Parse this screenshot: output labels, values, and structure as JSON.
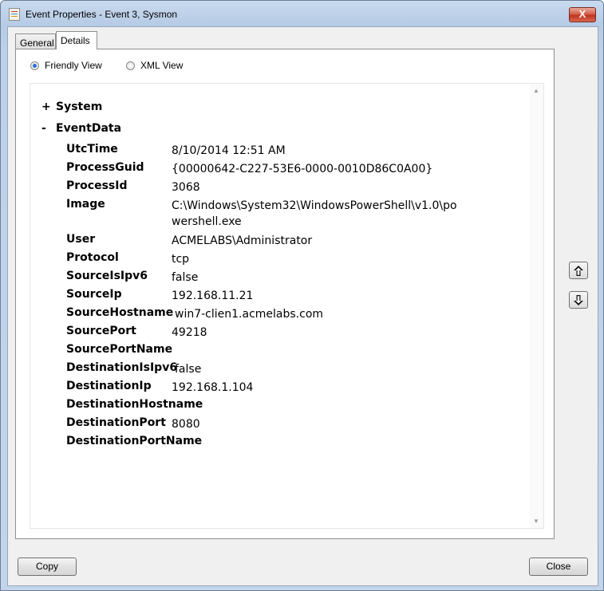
{
  "window": {
    "title": "Event Properties - Event 3, Sysmon",
    "close_glyph": "X"
  },
  "tabs": [
    {
      "label": "General"
    },
    {
      "label": "Details"
    }
  ],
  "view_options": {
    "friendly": "Friendly View",
    "xml": "XML View",
    "selected": "friendly"
  },
  "tree": {
    "system": {
      "symbol": "+",
      "label": "System"
    },
    "eventdata": {
      "symbol": "-",
      "label": "EventData"
    }
  },
  "rows": [
    {
      "key": "UtcTime",
      "value": "8/10/2014 12:51 AM"
    },
    {
      "key": "ProcessGuid",
      "value": "{00000642-C227-53E6-0000-0010D86C0A00}"
    },
    {
      "key": "ProcessId",
      "value": "3068"
    },
    {
      "key": "Image",
      "value": "C:\\Windows\\System32\\WindowsPowerShell\\v1.0\\powershell.exe"
    },
    {
      "key": "User",
      "value": "ACMELABS\\Administrator"
    },
    {
      "key": "Protocol",
      "value": "tcp"
    },
    {
      "key": "SourceIsIpv6",
      "value": "false"
    },
    {
      "key": "SourceIp",
      "value": "192.168.11.21"
    },
    {
      "key": "SourceHostname",
      "value": "win7-clien1.acmelabs.com"
    },
    {
      "key": "SourcePort",
      "value": "49218"
    },
    {
      "key": "SourcePortName",
      "value": ""
    },
    {
      "key": "DestinationIsIpv6",
      "value": "false"
    },
    {
      "key": "DestinationIp",
      "value": "192.168.1.104"
    },
    {
      "key": "DestinationHostname",
      "value": ""
    },
    {
      "key": "DestinationPort",
      "value": "8080"
    },
    {
      "key": "DestinationPortName",
      "value": ""
    }
  ],
  "buttons": {
    "copy": "Copy",
    "close": "Close"
  },
  "icons": {
    "up": "up-arrow-icon",
    "down": "down-arrow-icon"
  }
}
